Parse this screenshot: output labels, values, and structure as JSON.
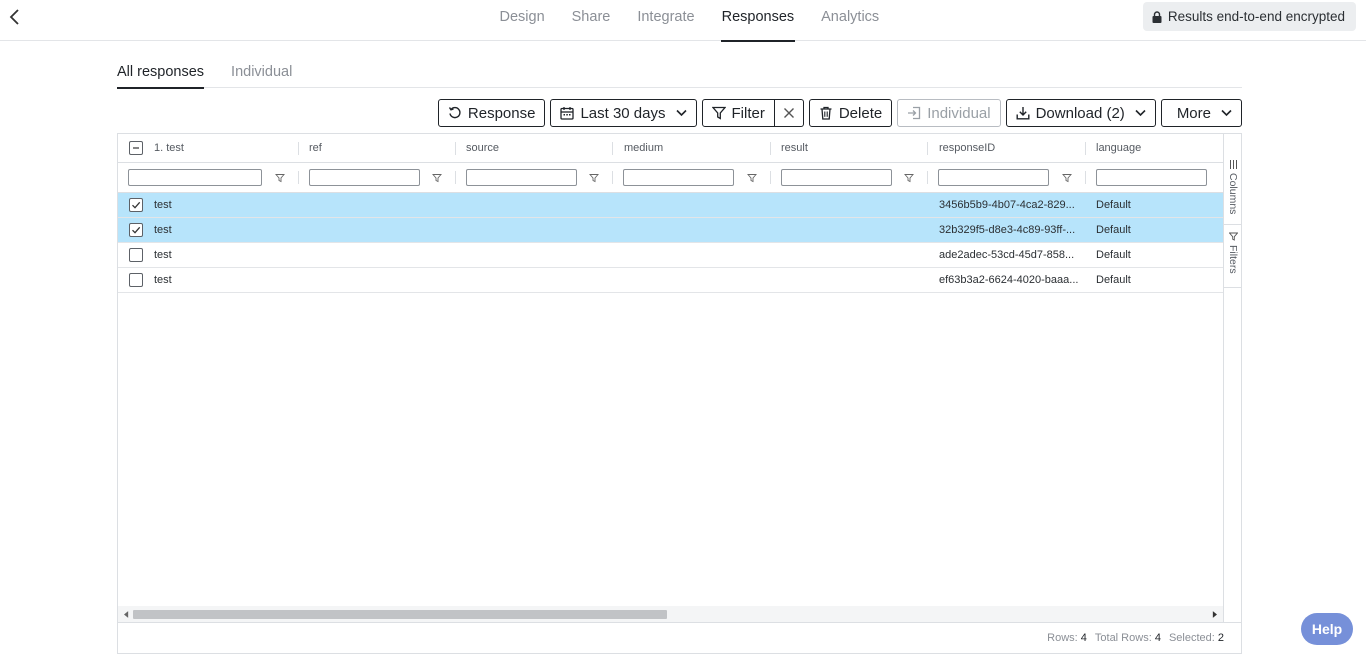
{
  "nav": {
    "back_icon": "chevron-left-icon",
    "tabs": [
      {
        "label": "Design"
      },
      {
        "label": "Share"
      },
      {
        "label": "Integrate"
      },
      {
        "label": "Responses",
        "active": true
      },
      {
        "label": "Analytics"
      }
    ],
    "encrypt_badge": "Results end-to-end encrypted"
  },
  "sub_tabs": [
    {
      "label": "All responses",
      "active": true
    },
    {
      "label": "Individual"
    }
  ],
  "toolbar": {
    "response_label": "Response",
    "date_range_label": "Last 30 days",
    "filter_label": "Filter",
    "delete_label": "Delete",
    "individual_label": "Individual",
    "download_label": "Download (2)",
    "more_label": "More"
  },
  "grid": {
    "columns": [
      "1. test",
      "ref",
      "source",
      "medium",
      "result",
      "responseID",
      "language"
    ],
    "rows": [
      {
        "selected": true,
        "test": "test",
        "responseID": "3456b5b9-4b07-4ca2-829...",
        "language": "Default"
      },
      {
        "selected": true,
        "test": "test",
        "responseID": "32b329f5-d8e3-4c89-93ff-...",
        "language": "Default"
      },
      {
        "selected": false,
        "test": "test",
        "responseID": "ade2adec-53cd-45d7-858...",
        "language": "Default"
      },
      {
        "selected": false,
        "test": "test",
        "responseID": "ef63b3a2-6624-4020-baaa...",
        "language": "Default"
      }
    ],
    "side_panel": {
      "columns_label": "Columns",
      "filters_label": "Filters"
    },
    "status": {
      "rows_label": "Rows:",
      "rows_value": "4",
      "total_label": "Total Rows:",
      "total_value": "4",
      "selected_label": "Selected:",
      "selected_value": "2"
    }
  },
  "help_label": "Help",
  "colors": {
    "selected_row": "#b7e4fb",
    "help_button": "#7690d9"
  }
}
